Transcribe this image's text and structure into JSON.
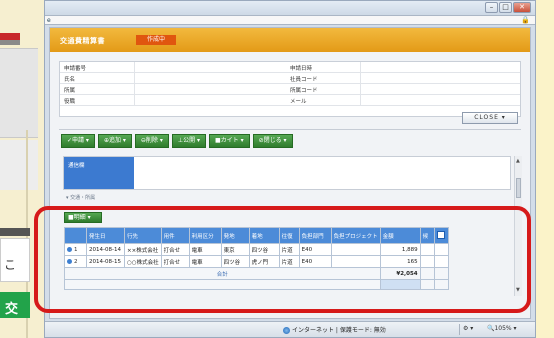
{
  "app": {
    "title": "交通費精算書",
    "status": "作成中",
    "close_label": "CLOSE ▾"
  },
  "info": {
    "rows": [
      {
        "left": "申請番号",
        "right": "申請日時"
      },
      {
        "left": "氏名",
        "right": "社員コード"
      },
      {
        "left": "所属",
        "right": "所属コード"
      },
      {
        "left": "役職",
        "right": "メール"
      }
    ]
  },
  "toolbar": {
    "buttons": [
      {
        "label": "✓申請 ▾"
      },
      {
        "label": "⊕追加 ▾"
      },
      {
        "label": "⊖削除 ▾"
      },
      {
        "label": "⊥公開 ▾"
      },
      {
        "label": "■カイト ▾"
      },
      {
        "label": "⊘閉じる ▾"
      }
    ]
  },
  "section": {
    "blue_label": "通信欄",
    "breadcrumb": "▾ 交通・所属"
  },
  "detail": {
    "button_label": "■明細 ▾",
    "headers": [
      "",
      "発生日",
      "行先",
      "用件",
      "利用区分",
      "発地",
      "着地",
      "往復",
      "負担部門",
      "負担プロジェクト",
      "金額",
      "候",
      ""
    ],
    "rows": [
      {
        "no": "1",
        "date": "2014-08-14",
        "dest": "××株式会社",
        "purpose": "打合せ",
        "kind": "電車",
        "from": "東京",
        "to": "四ツ谷",
        "rt": "片道",
        "dept": "E40",
        "proj": "",
        "amount": "1,889"
      },
      {
        "no": "2",
        "date": "2014-08-15",
        "dest": "○○株式会社",
        "purpose": "打合せ",
        "kind": "電車",
        "from": "四ツ谷",
        "to": "虎ノ門",
        "rt": "片道",
        "dept": "E40",
        "proj": "",
        "amount": "165"
      }
    ],
    "total_label": "合計",
    "total_value": "¥2,054"
  },
  "statusbar": {
    "zone": "インターネット | 保護モード: 無効",
    "opts": "⚙ ▾",
    "zoom": "🔍105% ▾"
  }
}
